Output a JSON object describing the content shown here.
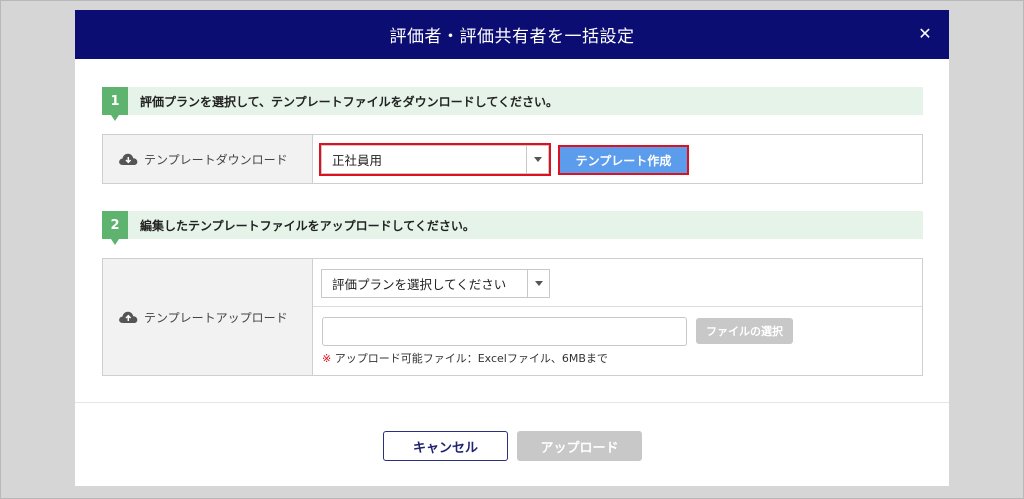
{
  "modal": {
    "title": "評価者・評価共有者を一括設定",
    "close_icon": "close-icon",
    "close_glyph": "✕"
  },
  "step1": {
    "number": "1",
    "text": "評価プランを選択して、テンプレートファイルをダウンロードしてください。",
    "label": "テンプレートダウンロード",
    "icon": "cloud-download-icon",
    "plan_select_value": "正社員用",
    "create_template_button": "テンプレート作成"
  },
  "step2": {
    "number": "2",
    "text": "編集したテンプレートファイルをアップロードしてください。",
    "label": "テンプレートアップロード",
    "icon": "cloud-upload-icon",
    "plan_select_value": "評価プランを選択してください",
    "file_input_value": "",
    "choose_file_button": "ファイルの選択",
    "note_mark": "※",
    "note_text": "アップロード可能ファイル：Excelファイル、6MBまで"
  },
  "footer": {
    "cancel_button": "キャンセル",
    "upload_button": "アップロード"
  },
  "colors": {
    "header_bg": "#0b0d73",
    "step_green": "#5eb46f",
    "step_bg": "#e6f3e9",
    "primary_button": "#5c9cec",
    "highlight": "#e0101e",
    "disabled": "#c8c8c8"
  }
}
